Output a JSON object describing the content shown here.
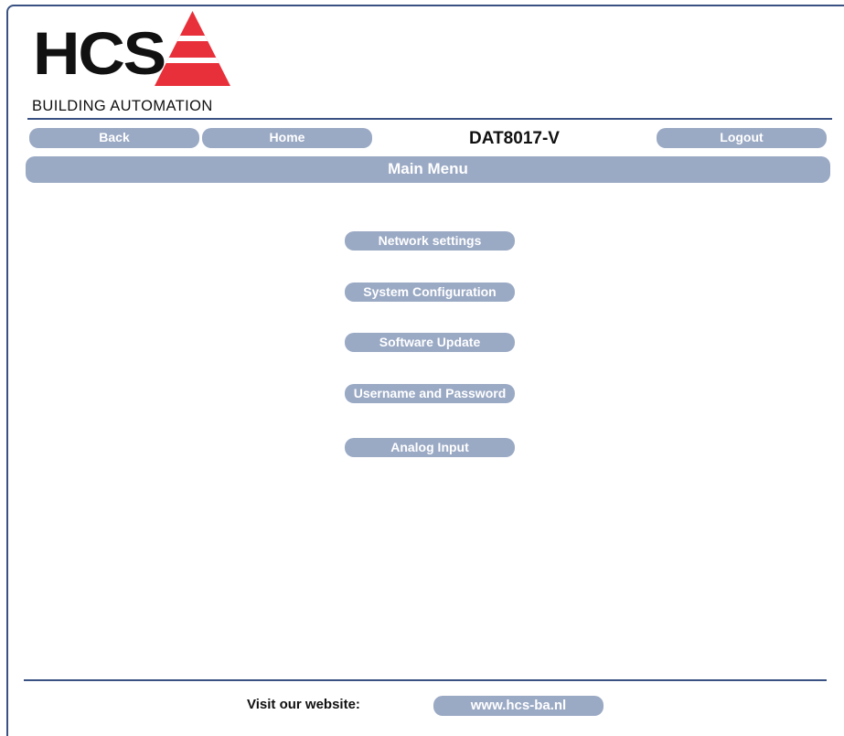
{
  "logo": {
    "wordmark": "HCS",
    "tagline": "BUILDING AUTOMATION",
    "triangle_color": "#e8303a"
  },
  "nav": {
    "back_label": "Back",
    "home_label": "Home",
    "device_title": "DAT8017-V",
    "logout_label": "Logout"
  },
  "main": {
    "title": "Main Menu",
    "menu_items": [
      {
        "label": "Network settings"
      },
      {
        "label": "System Configuration"
      },
      {
        "label": "Software Update"
      },
      {
        "label": "Username and Password"
      },
      {
        "label": "Analog Input"
      }
    ]
  },
  "footer": {
    "visit_label": "Visit our website:",
    "website_link": "www.hcs-ba.nl"
  },
  "colors": {
    "accent_navy": "#3a5283",
    "button_fill": "#9aa9c4",
    "button_text": "#ffffff"
  }
}
